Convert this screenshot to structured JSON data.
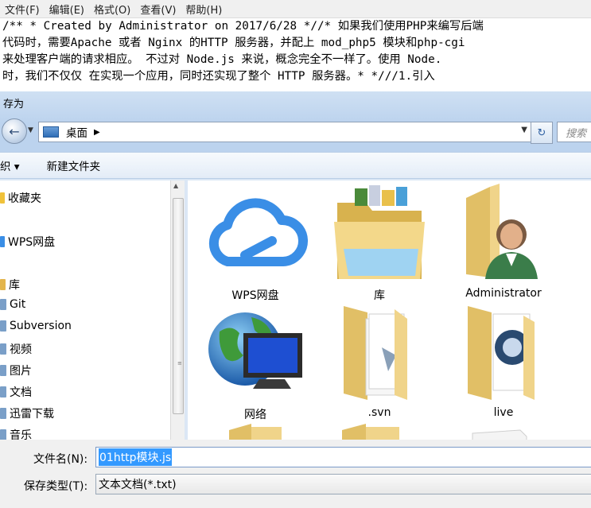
{
  "notepad": {
    "menu": [
      "文件(F)",
      "编辑(E)",
      "格式(O)",
      "查看(V)",
      "帮助(H)"
    ],
    "lines": [
      "/** * Created by Administrator on 2017/6/28 *//* 如果我们使用PHP来编写后端",
      "代码时，需要Apache 或者 Nginx 的HTTP 服务器，并配上 mod_php5 模块和php-cgi",
      "来处理客户端的请求相应。 不过对 Node.js 来说，概念完全不一样了。使用 Node.",
      "时，我们不仅仅 在实现一个应用，同时还实现了整个 HTTP 服务器。* *///1.引入"
    ]
  },
  "dialog": {
    "title": "存为",
    "address": "桌面",
    "search_placeholder": "搜索",
    "organize": "织",
    "new_folder": "新建文件夹",
    "nav_items": [
      {
        "label": "收藏夹",
        "icon": "star-icon"
      },
      {
        "label": "WPS网盘",
        "icon": "wps-cloud-icon"
      },
      {
        "label": "库",
        "icon": "library-icon"
      },
      {
        "label": "Git",
        "icon": "library-folder-icon"
      },
      {
        "label": "Subversion",
        "icon": "library-folder-icon"
      },
      {
        "label": "视频",
        "icon": "video-library-icon"
      },
      {
        "label": "图片",
        "icon": "picture-library-icon"
      },
      {
        "label": "文档",
        "icon": "document-library-icon"
      },
      {
        "label": "迅雷下载",
        "icon": "library-folder-icon"
      },
      {
        "label": "音乐",
        "icon": "music-library-icon"
      }
    ],
    "files": [
      {
        "label": "WPS网盘",
        "icon": "wps-cloud-icon"
      },
      {
        "label": "库",
        "icon": "libraries-folder-icon"
      },
      {
        "label": "Administrator",
        "icon": "user-folder-icon"
      },
      {
        "label": "网络",
        "icon": "network-globe-icon"
      },
      {
        "label": ".svn",
        "icon": "folder-icon"
      },
      {
        "label": "live",
        "icon": "folder-icon"
      }
    ],
    "filename_label": "文件名(N):",
    "filename_value": "01http模块.js",
    "filetype_label": "保存类型(T):",
    "filetype_value": "文本文档(*.txt)"
  },
  "colors": {
    "accent": "#3399ff",
    "cloud": "#3a8ee6",
    "folder": "#efcf78"
  }
}
